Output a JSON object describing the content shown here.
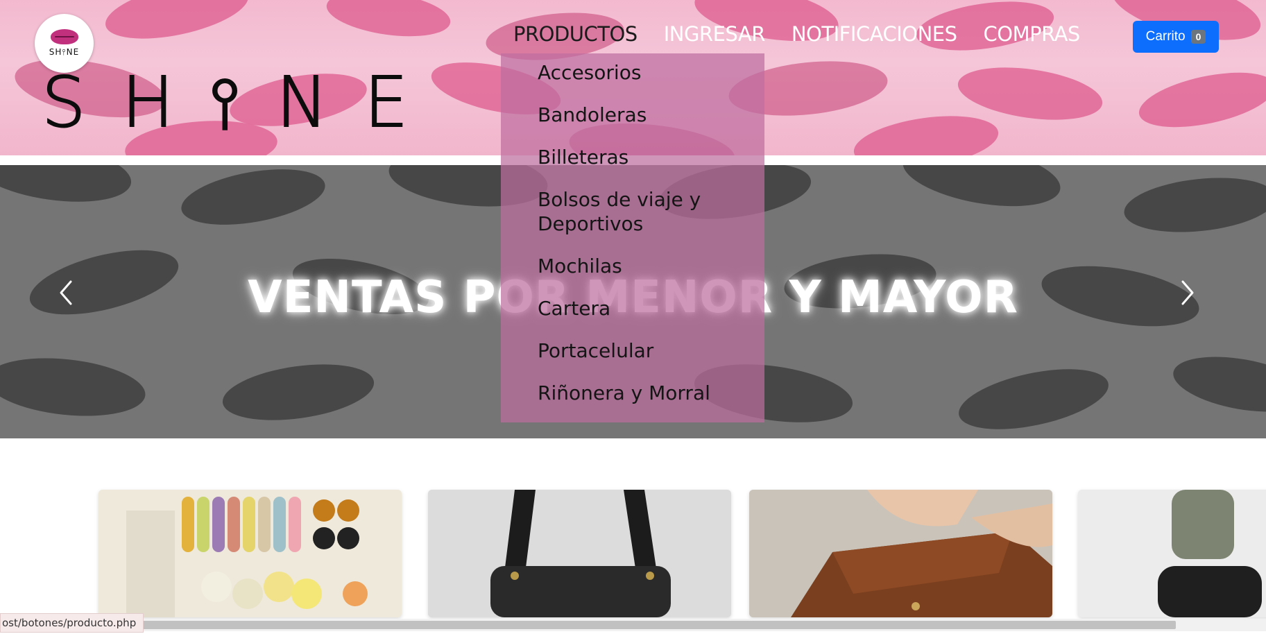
{
  "logo": {
    "text": "SH⫯NE"
  },
  "brand": {
    "text": "SH⫯NE"
  },
  "nav": {
    "items": [
      {
        "label": "PRODUCTOS",
        "active": true
      },
      {
        "label": "INGRESAR",
        "active": false
      },
      {
        "label": "NOTIFICACIONES",
        "active": false
      },
      {
        "label": "COMPRAS",
        "active": false
      }
    ]
  },
  "cart": {
    "label": "Carrito",
    "count": "0"
  },
  "dropdown": {
    "items": [
      "Accesorios",
      "Bandoleras",
      "Billeteras",
      "Bolsos de viaje y Deportivos",
      "Mochilas",
      "Cartera",
      "Portacelular",
      "Riñonera y Morral"
    ]
  },
  "carousel": {
    "slide_text": "VENTAS POR MENOR Y MAYOR",
    "prev_icon": "chevron-left-icon",
    "next_icon": "chevron-right-icon"
  },
  "status_bar": {
    "url": "ost/botones/producto.php"
  },
  "colors": {
    "header_bg": "#f3b9cf",
    "lip_pink": "#de5b8e",
    "cart_button": "#0d6efd",
    "dropdown_bg": "#be6ea0",
    "carousel_bg": "#757575"
  }
}
